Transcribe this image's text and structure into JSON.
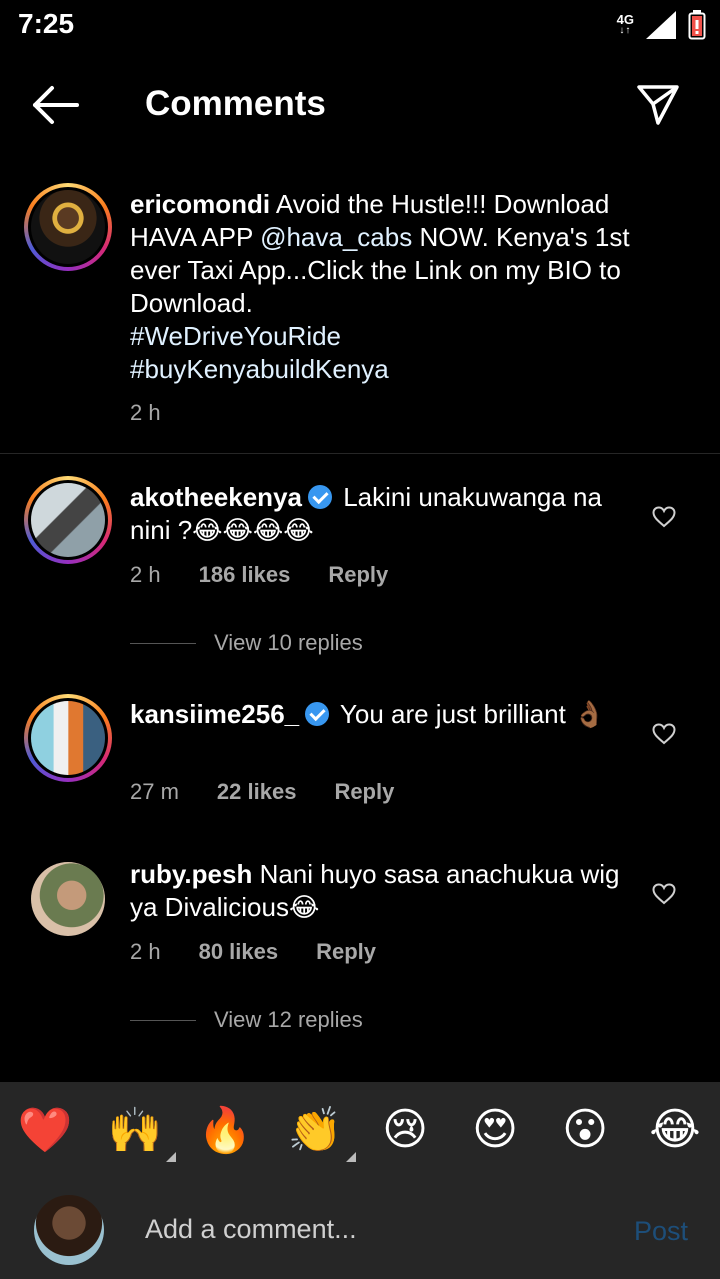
{
  "status": {
    "time": "7:25",
    "network": "4G",
    "arrows": "↓↑"
  },
  "header": {
    "title": "Comments"
  },
  "caption": {
    "username": "ericomondi",
    "text_before_mention": " Avoid the Hustle!!! Download HAVA APP ",
    "mention": "@hava_cabs",
    "text_after_mention": " NOW. Kenya's 1st ever Taxi App...Click the Link on my BIO to Download.",
    "hashtags": [
      "#WeDriveYouRide",
      "#buyKenyabuildKenya"
    ],
    "time": "2 h"
  },
  "comments": [
    {
      "username": "akotheekenya",
      "verified": true,
      "text": "Lakini unakuwanga na nini ?😂😂😂😂",
      "time": "2 h",
      "likes": "186 likes",
      "reply": "Reply",
      "view_replies": "View 10 replies"
    },
    {
      "username": "kansiime256_",
      "verified": true,
      "text": "You are just brilliant 👌🏾",
      "time": "27 m",
      "likes": "22 likes",
      "reply": "Reply"
    },
    {
      "username": "ruby.pesh",
      "verified": false,
      "text": "Nani huyo sasa anachukua wig ya Divalicious😂",
      "time": "2 h",
      "likes": "80 likes",
      "reply": "Reply",
      "view_replies": "View 12 replies"
    }
  ],
  "reactions": [
    "❤️",
    "🙌",
    "🔥",
    "👏",
    "😢",
    "😍",
    "😮",
    "😂"
  ],
  "composer": {
    "placeholder": "Add a comment...",
    "post": "Post"
  },
  "icons": {
    "back": "arrow-left-icon",
    "share": "paper-plane-icon",
    "like": "heart-outline-icon",
    "verified": "verified-badge-icon"
  },
  "colors": {
    "background": "#000000",
    "secondary_text": "#a8a8a8",
    "verified": "#3897f0",
    "post_disabled": "#1d4e79",
    "bar": "#262626"
  }
}
